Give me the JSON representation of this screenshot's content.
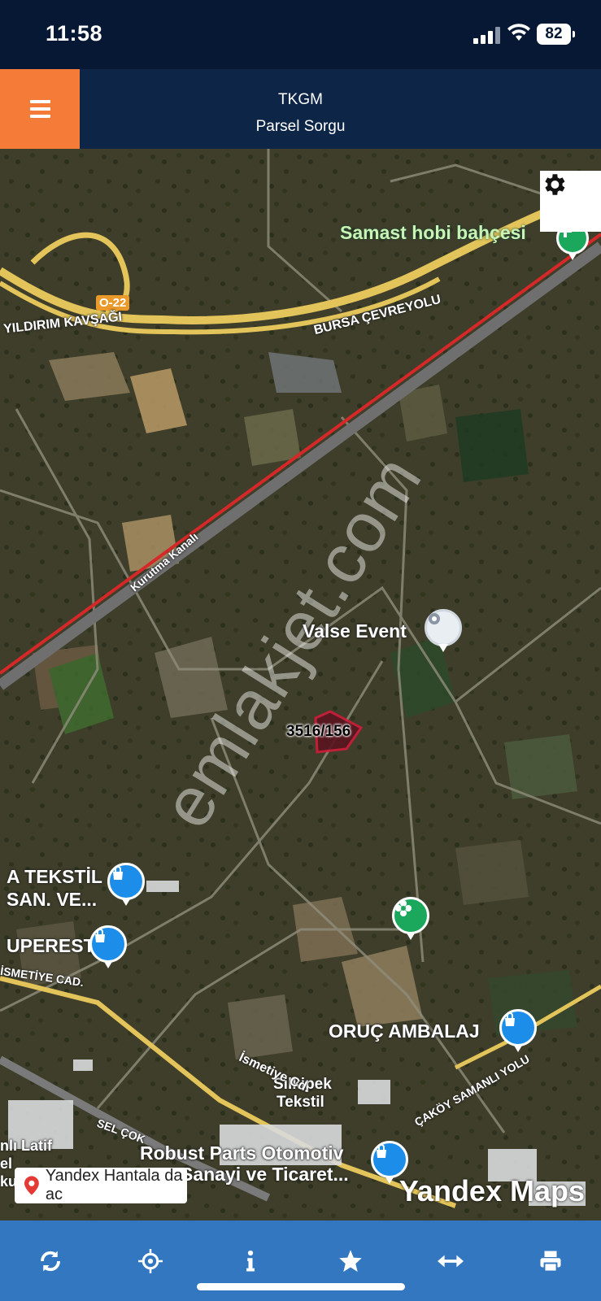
{
  "status": {
    "time": "11:58",
    "battery": "82",
    "icons": [
      "signal-icon",
      "wifi-icon",
      "battery-icon"
    ]
  },
  "header": {
    "title": "TKGM",
    "subtitle": "Parsel Sorgu",
    "menu_icon": "hamburger-icon",
    "accent": "#f47b38",
    "bg": "#0d2546"
  },
  "map": {
    "settings_icon": "gear-icon",
    "parcel": "3516/156",
    "labels": {
      "samast": "Samast hobi bahçesi",
      "valse": "Valse Event",
      "a_tekstil_1": "A TEKSTİL",
      "a_tekstil_2": "SAN. VE...",
      "uperest": "UPEREST",
      "oruc": "ORUÇ AMBALAJ",
      "silkipek_1": "Silkipek",
      "silkipek_2": "Tekstil",
      "robust_1": "Robust Parts Otomotiv",
      "robust_2": "Sanayi ve Ticaret...",
      "road_o22": "O-22",
      "road_yildirim": "YILDIRIM KAVŞAĞI",
      "road_bursa": "BURSA ÇEVREYOLU",
      "road_kurutma": "Kurutma Kanalı",
      "road_ismetiye": "İSMETİYE CAD.",
      "road_ismetiye2": "İsmetiye Cd.",
      "road_cakoy": "ÇAKÖY SAMANLI YOLU",
      "road_sel": "SEL ÇOK",
      "left_frag_1": "nlı Latif",
      "left_frag_2": "el",
      "left_frag_3": "kuru"
    },
    "watermark": "emlakjet.com",
    "yandex_pill": "Yandex Hantala da ac",
    "yandex_brand": "Yandex Maps"
  },
  "toolbar": {
    "buttons": [
      "refresh-icon",
      "locate-icon",
      "info-icon",
      "star-icon",
      "measure-icon",
      "print-icon"
    ],
    "bg": "#3277bf"
  }
}
